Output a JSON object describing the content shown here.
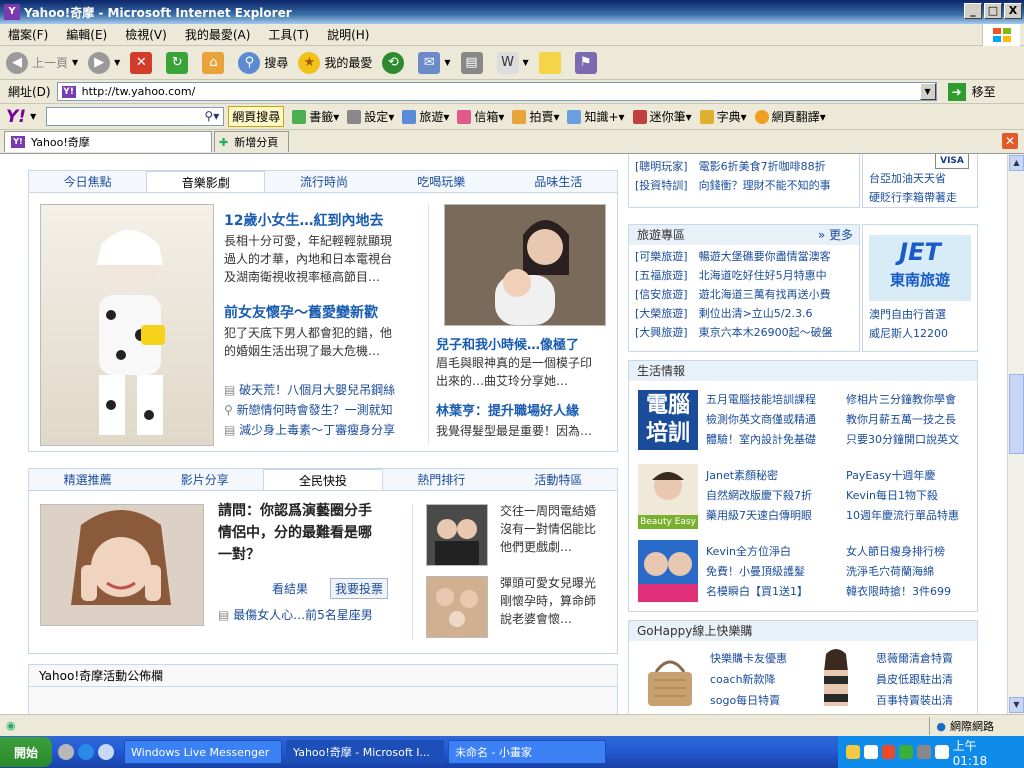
{
  "window": {
    "title": "Yahoo!奇摩 - Microsoft Internet Explorer",
    "minimize": "_",
    "maximize": "□",
    "close": "X"
  },
  "menu": [
    "檔案(F)",
    "編輯(E)",
    "檢視(V)",
    "我的最愛(A)",
    "工具(T)",
    "說明(H)"
  ],
  "toolbar": {
    "back": "上一頁",
    "search": "搜尋",
    "favorites": "我的最愛"
  },
  "address": {
    "label": "網址(D)",
    "url": "http://tw.yahoo.com/",
    "go": "移至"
  },
  "ybar": {
    "logo": "Y!",
    "search_btn": "網頁搜尋",
    "items": [
      "書籤",
      "設定",
      "旅遊",
      "信箱",
      "拍賣",
      "知識+",
      "迷你筆",
      "字典",
      "網頁翻譯"
    ]
  },
  "tabs": {
    "current": "Yahoo!奇摩",
    "new": "新增分頁"
  },
  "top_module": {
    "tabs": [
      "今日焦點",
      "音樂影劇",
      "流行時尚",
      "吃喝玩樂",
      "品味生活"
    ],
    "active": 1,
    "h1": "12歲小女生…紅到內地去",
    "b1": [
      "長相十分可愛，年紀輕輕就顯現",
      "過人的才華，內地和日本電視台",
      "及湖南衛視收視率極高節目…"
    ],
    "h2": "前女友懷孕～舊愛變新歡",
    "b2": [
      "犯了天底下男人都會犯的錯，他",
      "的婚姻生活出現了最大危機…"
    ],
    "links": [
      "破天荒！八個月大嬰兒吊鋼絲",
      "新戀情何時會發生？一測就知",
      "減少身上毒素～丁審瘦身分享"
    ],
    "h3": "兒子和我小時候…像極了",
    "b3": [
      "眉毛與眼神真的是一個模子印",
      "出來的…曲艾玲分享她…"
    ],
    "h4": "林葉亨：提升職場好人緣",
    "b4": [
      "我覺得髮型最是重要！因為…"
    ]
  },
  "mid_module": {
    "tabs": [
      "精選推薦",
      "影片分享",
      "全民快投",
      "熱門排行",
      "活動特區"
    ],
    "active": 2,
    "q": [
      "請問：你認爲演藝圈分手",
      "情侶中，分的最難看是哪",
      "一對？"
    ],
    "results": "看結果",
    "vote": "我要投票",
    "link": "最傷女人心…前5名星座男",
    "s1": [
      "交往一周閃電結婚",
      "沒有一對情侶能比",
      "他們更戲劇…"
    ],
    "s2": [
      "彈頭可愛女兒曝光",
      "剛懷孕時，算命師",
      "說老婆會懷…"
    ]
  },
  "activity": {
    "head": "Yahoo!奇摩活動公佈欄"
  },
  "sidebar": {
    "top_items": [
      "[聰明玩家]　電影6折美食7折咖啡88折",
      "[投資特訓]　向錢衝？理財不能不知的事"
    ],
    "top_right": [
      "台亞加油天天省",
      "硬貶行李箱帶著走"
    ],
    "travel_head": "旅遊專區",
    "more": "» 更多",
    "travel": [
      "[可樂旅遊]　暢遊大堡礁要你盡情當澳客",
      "[五福旅遊]　北海道吃好住好5月特惠中",
      "[信安旅遊]　遊北海道三萬有找再送小費",
      "[大榮旅遊]　剩位出清>立山5/2.3.6",
      "[大興旅遊]　東京六本木26900起～破盤"
    ],
    "jet": [
      "JET",
      "東南旅遊"
    ],
    "jet_links": [
      "澳門自由行首選",
      "威尼斯人12200"
    ],
    "life_head": "生活情報",
    "pc": [
      "電腦",
      "培訓"
    ],
    "life1": [
      "五月電腦技能培訓課程",
      "檢測你英文商僅或精通",
      "體驗！室內設計免基礎"
    ],
    "life1r": [
      "修相片三分鐘教你學會",
      "教你月薪五萬一技之長",
      "只要30分鐘開口說英文"
    ],
    "life2": [
      "Janet素顏秘密",
      "自然網改版慶下殺7折",
      "藥用級7天速白傳明眼"
    ],
    "life2r": [
      "PayEasy十週年慶",
      "Kevin每日1物下殺",
      "10週年慶流行單品特惠"
    ],
    "beauty": "Beauty Easy",
    "life3": [
      "Kevin全方位淨白",
      "免費！小曼頂級護髮",
      "名模瞬白【買1送1】"
    ],
    "life3r": [
      "女人節日瘦身排行榜",
      "洗淨毛穴荷蘭海綿",
      "韓衣限時搶！3件699"
    ],
    "go_head": "GoHappy線上快樂購",
    "go1": [
      "快樂購卡友優惠",
      "coach新款降",
      "sogo每日特賣"
    ],
    "go2": [
      "思薇爾清倉特賣",
      "員皮低跟駐出清",
      "百事特賣裝出清"
    ]
  },
  "status": {
    "zone": "網際網路"
  },
  "taskbar": {
    "start": "開始",
    "tasks": [
      "Windows Live Messenger",
      "Yahoo!奇摩 - Microsoft I...",
      "未命名 - 小畫家"
    ],
    "clock": "上午 01:18"
  }
}
